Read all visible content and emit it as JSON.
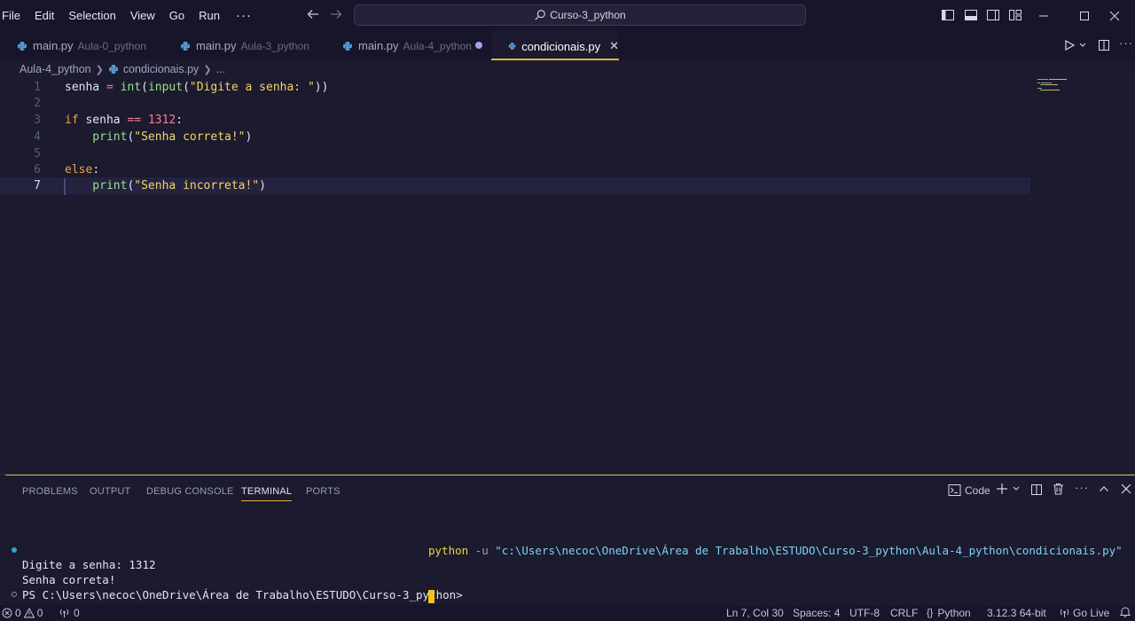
{
  "menu": [
    "File",
    "Edit",
    "Selection",
    "View",
    "Go",
    "Run"
  ],
  "menu_more": "···",
  "search_box": {
    "text": "Curso-3_python"
  },
  "tabs": [
    {
      "name": "main.py",
      "dir": "Aula-0_python"
    },
    {
      "name": "main.py",
      "dir": "Aula-3_python"
    },
    {
      "name": "main.py",
      "dir": "Aula-4_python"
    },
    {
      "name": "condicionais.py",
      "dir": ""
    }
  ],
  "breadcrumb": {
    "folder": "Aula-4_python",
    "file": "condicionais.py",
    "more": "..."
  },
  "editor": {
    "line_numbers": [
      "1",
      "2",
      "3",
      "4",
      "5",
      "6",
      "7"
    ],
    "lines": [
      {
        "t1": "senha",
        "t2": " = ",
        "t3": "int",
        "t4": "(",
        "t5": "input",
        "t6": "(",
        "t7": "\"Digite a senha: \"",
        "t8": "))"
      },
      {},
      {
        "t1": "if",
        "t2": " senha ",
        "t3": "==",
        "t4": " ",
        "t5": "1312",
        "t6": ":"
      },
      {
        "t1": "    print",
        "t2": "(",
        "t3": "\"Senha correta!\"",
        "t4": ")"
      },
      {},
      {
        "t1": "else",
        "t2": ":"
      },
      {
        "t1": "    print",
        "t2": "(",
        "t3": "\"Senha incorreta!\"",
        "t4": ")"
      }
    ],
    "current_line": 7
  },
  "panel": {
    "tabs": [
      "PROBLEMS",
      "OUTPUT",
      "DEBUG CONSOLE",
      "TERMINAL",
      "PORTS"
    ],
    "active_tab": "TERMINAL",
    "terminal_profile": "Code",
    "terminal": {
      "cmd_prog": "python",
      "cmd_flag": " -u ",
      "cmd_path": "\"c:\\Users\\necoc\\OneDrive\\Área de Trabalho\\ESTUDO\\Curso-3_python\\Aula-4_python\\condicionais.py\"",
      "line1": "Digite a senha: 1312",
      "line2": "Senha correta!",
      "prompt": "PS C:\\Users\\necoc\\OneDrive\\Área de Trabalho\\ESTUDO\\Curso-3_python> "
    }
  },
  "status": {
    "errors": "0",
    "warnings": "0",
    "ports": "0",
    "position": "Ln 7, Col 30",
    "spaces": "Spaces: 4",
    "encoding": "UTF-8",
    "eol": "CRLF",
    "language": "Python",
    "interpreter": "3.12.3 64-bit",
    "golive": "Go Live"
  },
  "colors": {
    "accent": "#e2b43c",
    "background": "#1b1a2e",
    "keyword": "#f0a04b",
    "string": "#f5d56a",
    "function": "#9be28a",
    "number": "#ff7a9a",
    "terminal_path": "#7fd2f2"
  },
  "icons": [
    "search-icon",
    "arrow-left-icon",
    "arrow-right-icon",
    "python-file-icon",
    "close-icon",
    "run-icon",
    "split-editor-icon",
    "terminal-icon",
    "plus-icon",
    "trash-icon",
    "maximize-icon",
    "close-panel-icon",
    "bell-icon",
    "broadcast-icon"
  ]
}
